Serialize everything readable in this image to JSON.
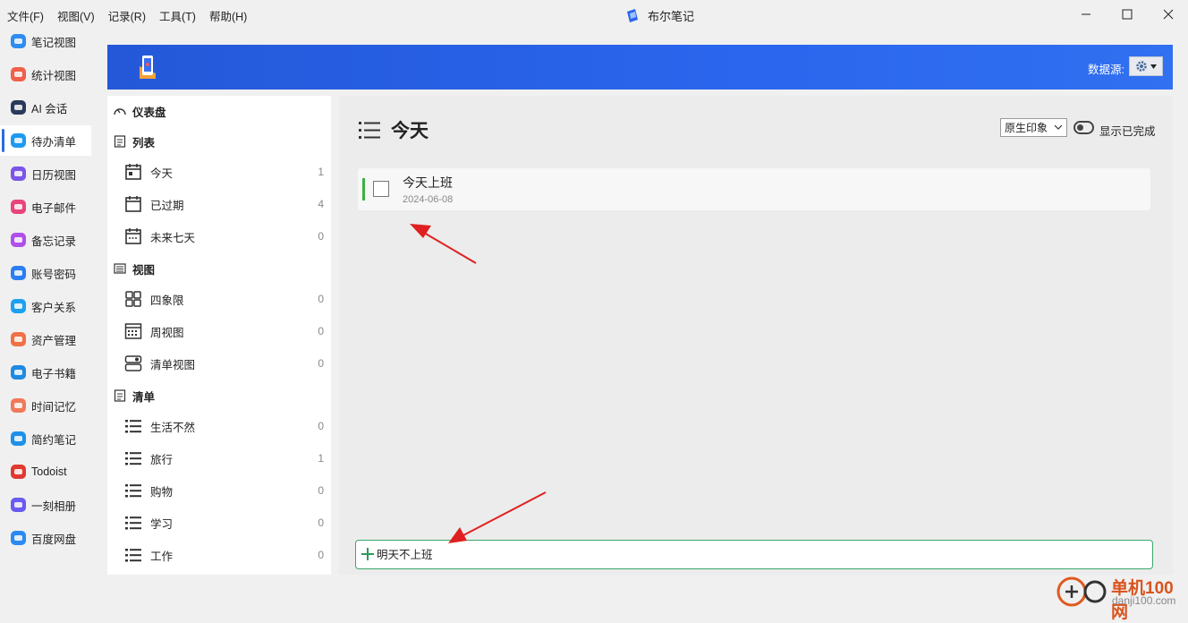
{
  "menu": [
    "文件(F)",
    "视图(V)",
    "记录(R)",
    "工具(T)",
    "帮助(H)"
  ],
  "app_title": "布尔笔记",
  "nav": [
    {
      "label": "笔记视图",
      "icon": "cloud-note-icon",
      "color": "#2e8cf0"
    },
    {
      "label": "统计视图",
      "icon": "stats-icon",
      "color": "#f0604a"
    },
    {
      "label": "AI 会话",
      "icon": "robot-icon",
      "color": "#2a3a5a"
    },
    {
      "label": "待办清单",
      "icon": "todo-icon",
      "color": "#1e9af0"
    },
    {
      "label": "日历视图",
      "icon": "calendar-icon",
      "color": "#7a55e8"
    },
    {
      "label": "电子邮件",
      "icon": "email-icon",
      "color": "#e8457a"
    },
    {
      "label": "备忘记录",
      "icon": "memo-icon",
      "color": "#b050e8"
    },
    {
      "label": "账号密码",
      "icon": "password-icon",
      "color": "#2a7ef0"
    },
    {
      "label": "客户关系",
      "icon": "customer-icon",
      "color": "#1ea0f0"
    },
    {
      "label": "资产管理",
      "icon": "asset-icon",
      "color": "#f07048"
    },
    {
      "label": "电子书籍",
      "icon": "ebook-icon",
      "color": "#1e8ae0"
    },
    {
      "label": "时间记忆",
      "icon": "time-memory-icon",
      "color": "#f07a5a"
    },
    {
      "label": "简约笔记",
      "icon": "simple-note-icon",
      "color": "#1e90e8"
    },
    {
      "label": "Todoist",
      "icon": "todoist-icon",
      "color": "#e03a30"
    },
    {
      "label": "一刻相册",
      "icon": "album-icon",
      "color": "#6a5af0"
    },
    {
      "label": "百度网盘",
      "icon": "baidu-pan-icon",
      "color": "#2a8af0"
    }
  ],
  "active_nav_index": 3,
  "banner": {
    "data_source_label": "数据源:"
  },
  "sidebar": {
    "dashboard": "仪表盘",
    "list_section": "列表",
    "lists": [
      {
        "label": "今天",
        "count": "1",
        "icon": "calendar-today-icon"
      },
      {
        "label": "已过期",
        "count": "4",
        "icon": "calendar-overdue-icon"
      },
      {
        "label": "未来七天",
        "count": "0",
        "icon": "calendar-week-icon"
      }
    ],
    "view_section": "视图",
    "views": [
      {
        "label": "四象限",
        "count": "0",
        "icon": "quadrant-icon"
      },
      {
        "label": "周视图",
        "count": "0",
        "icon": "week-grid-icon"
      },
      {
        "label": "清单视图",
        "count": "0",
        "icon": "list-view-icon"
      }
    ],
    "checklist_section": "清单",
    "checklists": [
      {
        "label": "生活不然",
        "count": "0"
      },
      {
        "label": "旅行",
        "count": "1"
      },
      {
        "label": "购物",
        "count": "0"
      },
      {
        "label": "学习",
        "count": "0"
      },
      {
        "label": "工作",
        "count": "0"
      }
    ]
  },
  "main": {
    "title": "今天",
    "select_value": "原生印象",
    "show_completed_label": "显示已完成",
    "tasks": [
      {
        "title": "今天上班",
        "date": "2024-06-08"
      }
    ],
    "new_task_value": "明天不上班"
  },
  "watermark": {
    "text1": "单机100网",
    "text2": "danji100.com"
  }
}
